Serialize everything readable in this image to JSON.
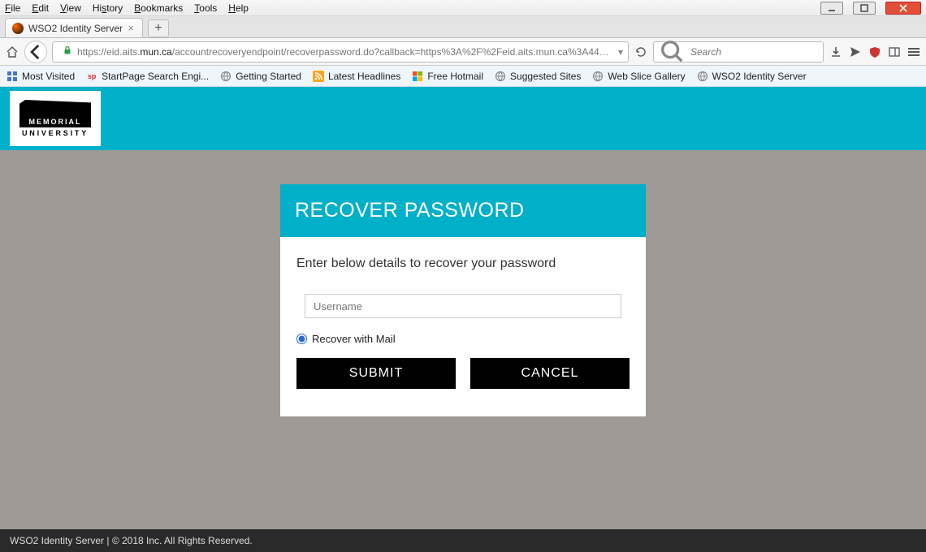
{
  "menu": {
    "file": "File",
    "edit": "Edit",
    "view": "View",
    "history": "History",
    "bookmarks": "Bookmarks",
    "tools": "Tools",
    "help": "Help"
  },
  "tab": {
    "title": "WSO2 Identity Server"
  },
  "url": {
    "pre": "https://eid.aits.",
    "host": "mun.ca",
    "post": "/accountrecoveryendpoint/recoverpassword.do?callback=https%3A%2F%2Feid.aits.mun.ca%3A443%2Fauthentic"
  },
  "search": {
    "placeholder": "Search"
  },
  "bookmarks": [
    {
      "label": "Most Visited",
      "icon": "grid"
    },
    {
      "label": "StartPage Search Engi...",
      "icon": "sp"
    },
    {
      "label": "Getting Started",
      "icon": "globe"
    },
    {
      "label": "Latest Headlines",
      "icon": "rss"
    },
    {
      "label": "Free Hotmail",
      "icon": "ms"
    },
    {
      "label": "Suggested Sites",
      "icon": "globe"
    },
    {
      "label": "Web Slice Gallery",
      "icon": "globe"
    },
    {
      "label": "WSO2 Identity Server",
      "icon": "globe"
    }
  ],
  "logo": {
    "line1": "MEMORIAL",
    "line2": "UNIVERSITY"
  },
  "card": {
    "title": "RECOVER PASSWORD",
    "lead": "Enter below details to recover your password",
    "username_placeholder": "Username",
    "radio_label": "Recover with Mail",
    "submit": "SUBMIT",
    "cancel": "CANCEL"
  },
  "footer": "WSO2 Identity Server | © 2018 Inc. All Rights Reserved."
}
